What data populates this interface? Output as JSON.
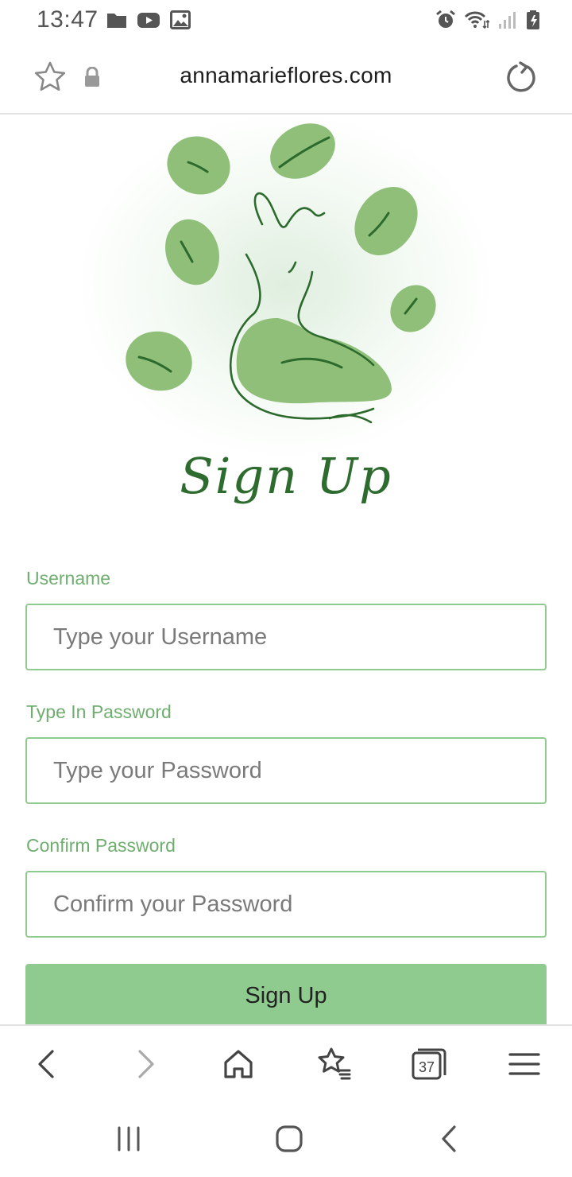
{
  "status_bar": {
    "time": "13:47",
    "left_icons": [
      "folder-icon",
      "youtube-icon",
      "image-icon"
    ],
    "right_icons": [
      "alarm-icon",
      "wifi-icon",
      "signal-icon",
      "battery-icon"
    ]
  },
  "address_bar": {
    "url": "annamarieflores.com",
    "bookmark_icon": "star-icon",
    "secure_icon": "lock-icon",
    "reload_icon": "reload-icon"
  },
  "hero": {
    "title": "Sign Up"
  },
  "form": {
    "username": {
      "label": "Username",
      "placeholder": "Type your Username",
      "value": ""
    },
    "password": {
      "label": "Type In Password",
      "placeholder": "Type your Password",
      "value": ""
    },
    "confirm": {
      "label": "Confirm Password",
      "placeholder": "Confirm your Password",
      "value": ""
    },
    "submit_label": "Sign Up"
  },
  "toolbar": {
    "tab_count": "37",
    "items": [
      "back-icon",
      "forward-icon",
      "home-icon",
      "bookmarks-icon",
      "tabs-icon",
      "menu-icon"
    ]
  },
  "nav_bar": {
    "items": [
      "recents-icon",
      "home-circle-icon",
      "back-chevron-icon"
    ]
  },
  "colors": {
    "accent": "#8fcb8f",
    "label": "#6fae6f",
    "leaf": "#8fc07a",
    "ink": "#2e6b2e"
  }
}
